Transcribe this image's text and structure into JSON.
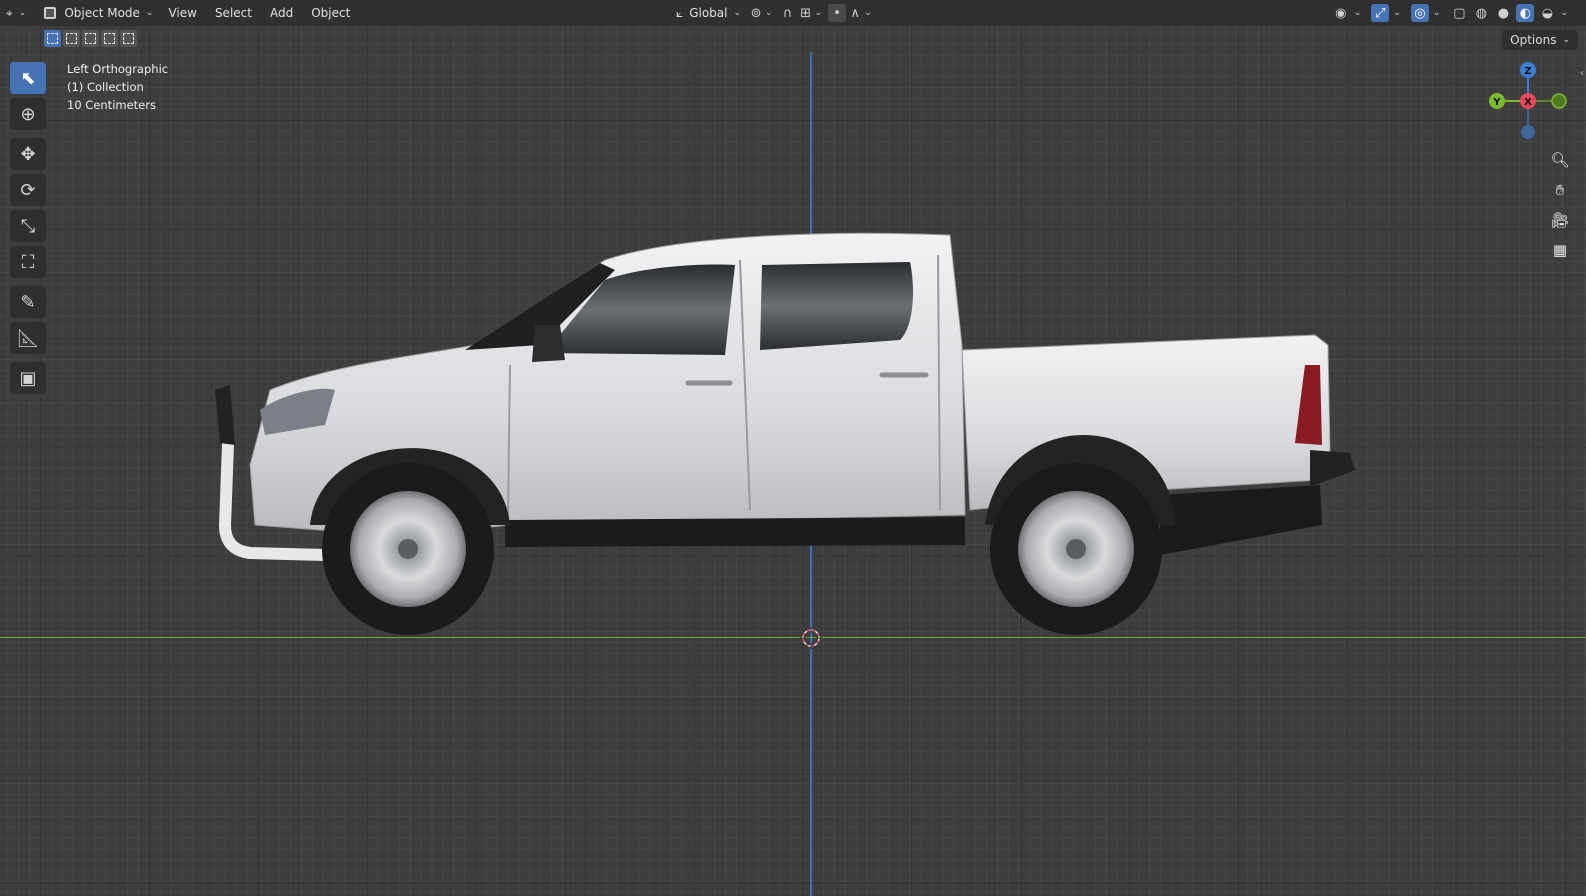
{
  "header": {
    "editor_type_icon": "3d-viewport-icon",
    "mode_label": "Object Mode",
    "menus": [
      "View",
      "Select",
      "Add",
      "Object"
    ],
    "transform_orientation": "Global",
    "pivot_icon": "pivot-point-icon",
    "snap_icon": "snap-magnet-icon",
    "proportional_icon": "proportional-editing-icon"
  },
  "options_label": "Options",
  "view_info": {
    "view_name": "Left Orthographic",
    "collection": "(1) Collection",
    "scale": "10 Centimeters"
  },
  "gizmo": {
    "z_label": "Z",
    "y_label": "Y",
    "x_label": "X",
    "colors": {
      "x": "#e8465f",
      "y": "#7dbb2e",
      "z": "#3d7ed4"
    }
  },
  "toolbar": {
    "tools": [
      "select-box-icon",
      "cursor-icon",
      "move-icon",
      "rotate-icon",
      "scale-icon",
      "transform-icon",
      "annotate-icon",
      "measure-icon",
      "add-cube-icon"
    ]
  },
  "colors": {
    "accent": "#4772b3",
    "grid_bg": "#3d3d3d",
    "axis_y": "#3a70b8",
    "axis_x": "#6ea83a"
  }
}
